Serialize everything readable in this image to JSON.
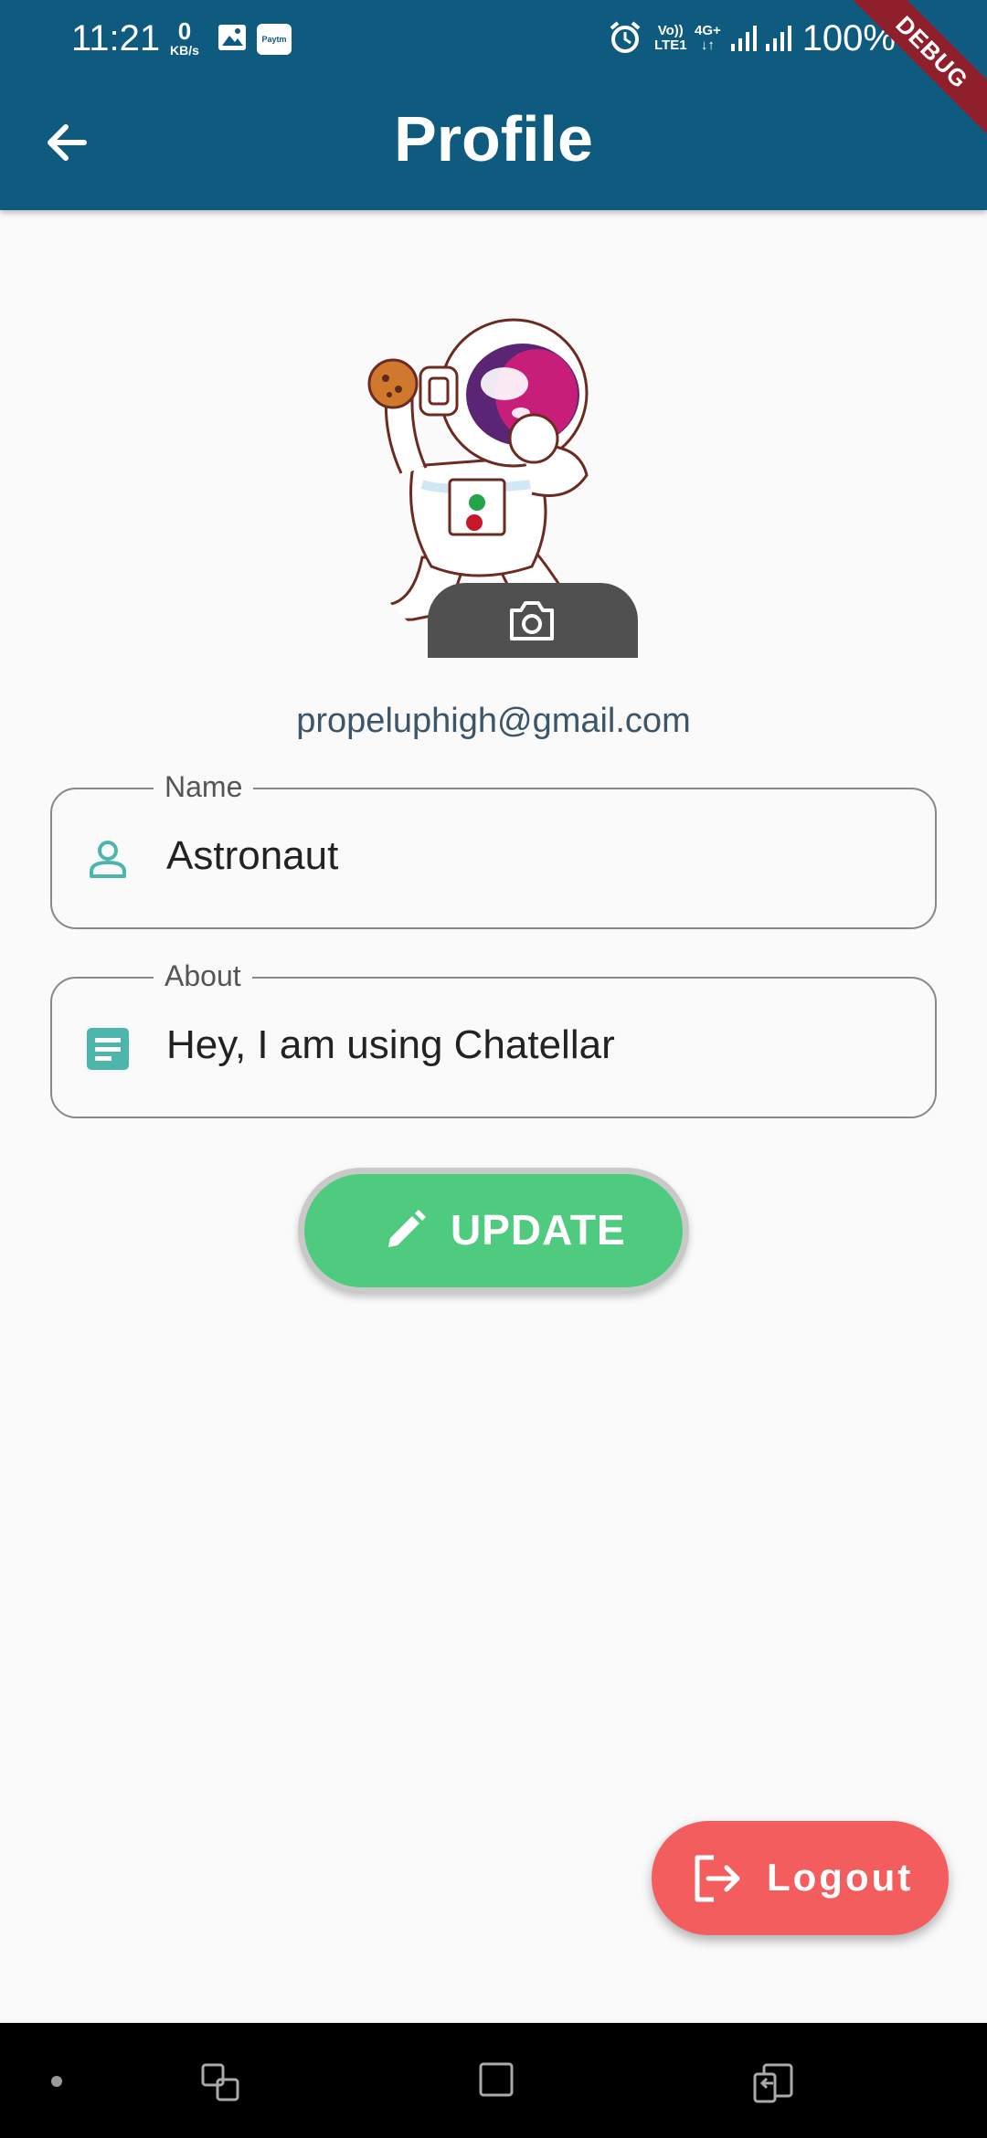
{
  "status_bar": {
    "time": "11:21",
    "speed_value": "0",
    "speed_unit": "KB/s",
    "paytm_label": "Paytm",
    "volte_label_1": "Vo))",
    "volte_label_2": "LTE1",
    "network_label": "4G+",
    "battery": "100%",
    "debug_banner": "DEBUG"
  },
  "app_bar": {
    "title": "Profile"
  },
  "profile": {
    "email": "propeluphigh@gmail.com"
  },
  "form": {
    "name": {
      "label": "Name",
      "value": "Astronaut"
    },
    "about": {
      "label": "About",
      "value": "Hey, I am using Chatellar"
    }
  },
  "actions": {
    "update_label": "UPDATE",
    "logout_label": "Logout"
  },
  "colors": {
    "app_bar": "#0f5b80",
    "accent_teal": "#4db6ac",
    "update_green": "#4fcb7f",
    "logout_red": "#f45d5d"
  }
}
